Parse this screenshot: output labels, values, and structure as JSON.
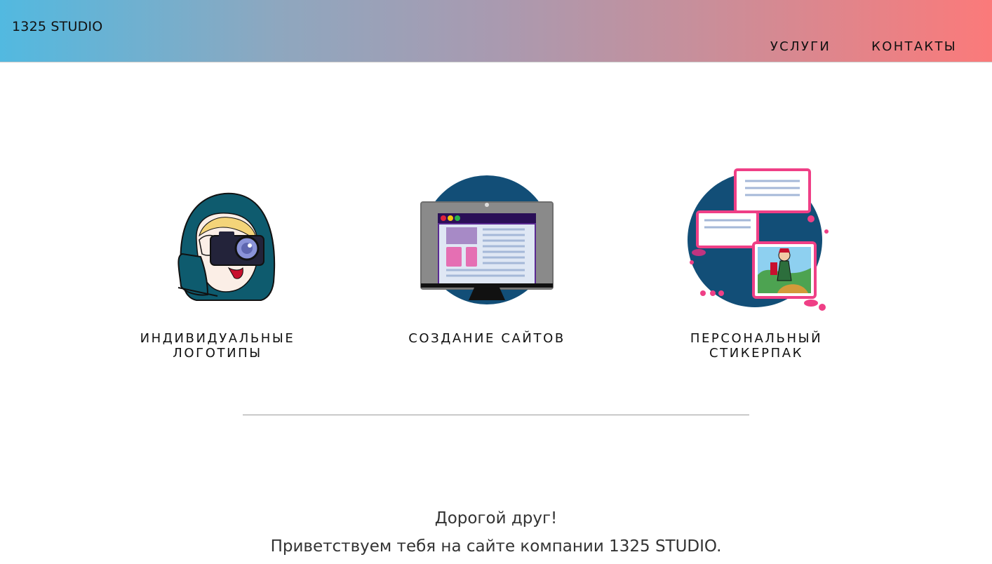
{
  "header": {
    "logo": "1325 STUDIO",
    "nav": [
      {
        "label": "УСЛУГИ"
      },
      {
        "label": "КОНТАКТЫ"
      }
    ],
    "gradient_colors": [
      "#52b9e0",
      "#fb7a7a"
    ]
  },
  "services": [
    {
      "label": "ИНДИВИДУАЛЬНЫЕ\nЛОГОТИПЫ",
      "icon": "girl-with-camera-icon"
    },
    {
      "label": "СОЗДАНИЕ САЙТОВ",
      "icon": "monitor-website-icon"
    },
    {
      "label": "ПЕРСОНАЛЬНЫЙ\nСТИКЕРПАК",
      "icon": "sticker-chat-icon"
    }
  ],
  "intro": {
    "line1": "Дорогой друг!",
    "line2": "Приветствуем тебя на сайте компании 1325 STUDIO."
  }
}
